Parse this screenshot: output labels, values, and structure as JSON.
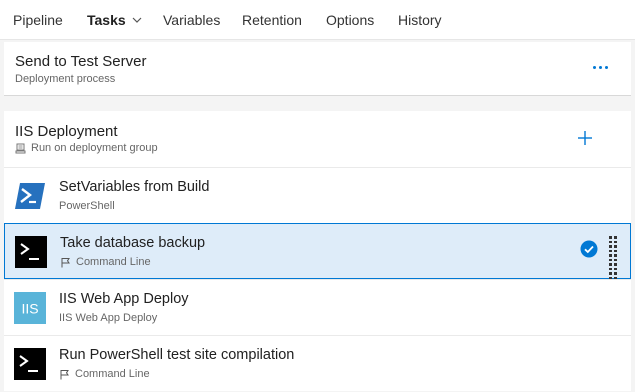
{
  "tabs": [
    {
      "label": "Pipeline"
    },
    {
      "label": "Tasks"
    },
    {
      "label": "Variables"
    },
    {
      "label": "Retention"
    },
    {
      "label": "Options"
    },
    {
      "label": "History"
    }
  ],
  "header": {
    "title": "Send to Test Server",
    "subtitle": "Deployment process"
  },
  "phase": {
    "title": "IIS Deployment",
    "subtitle": "Run on deployment group"
  },
  "tasks": [
    {
      "name": "SetVariables from Build",
      "type": "PowerShell",
      "icon": "powershell-icon"
    },
    {
      "name": "Take database backup",
      "type": "Command Line",
      "icon": "command-line-icon",
      "selected": true
    },
    {
      "name": "IIS Web App Deploy",
      "type": "IIS Web App Deploy",
      "icon": "iis-icon",
      "icon_text": "IIS"
    },
    {
      "name": "Run PowerShell test site compilation",
      "type": "Command Line",
      "icon": "command-line-icon"
    }
  ],
  "colors": {
    "accent": "#0078d4",
    "selected_bg": "#deecf9",
    "powershell_blue": "#2671be",
    "iis_blue": "#59b4d9",
    "terminal_black": "#000000"
  }
}
